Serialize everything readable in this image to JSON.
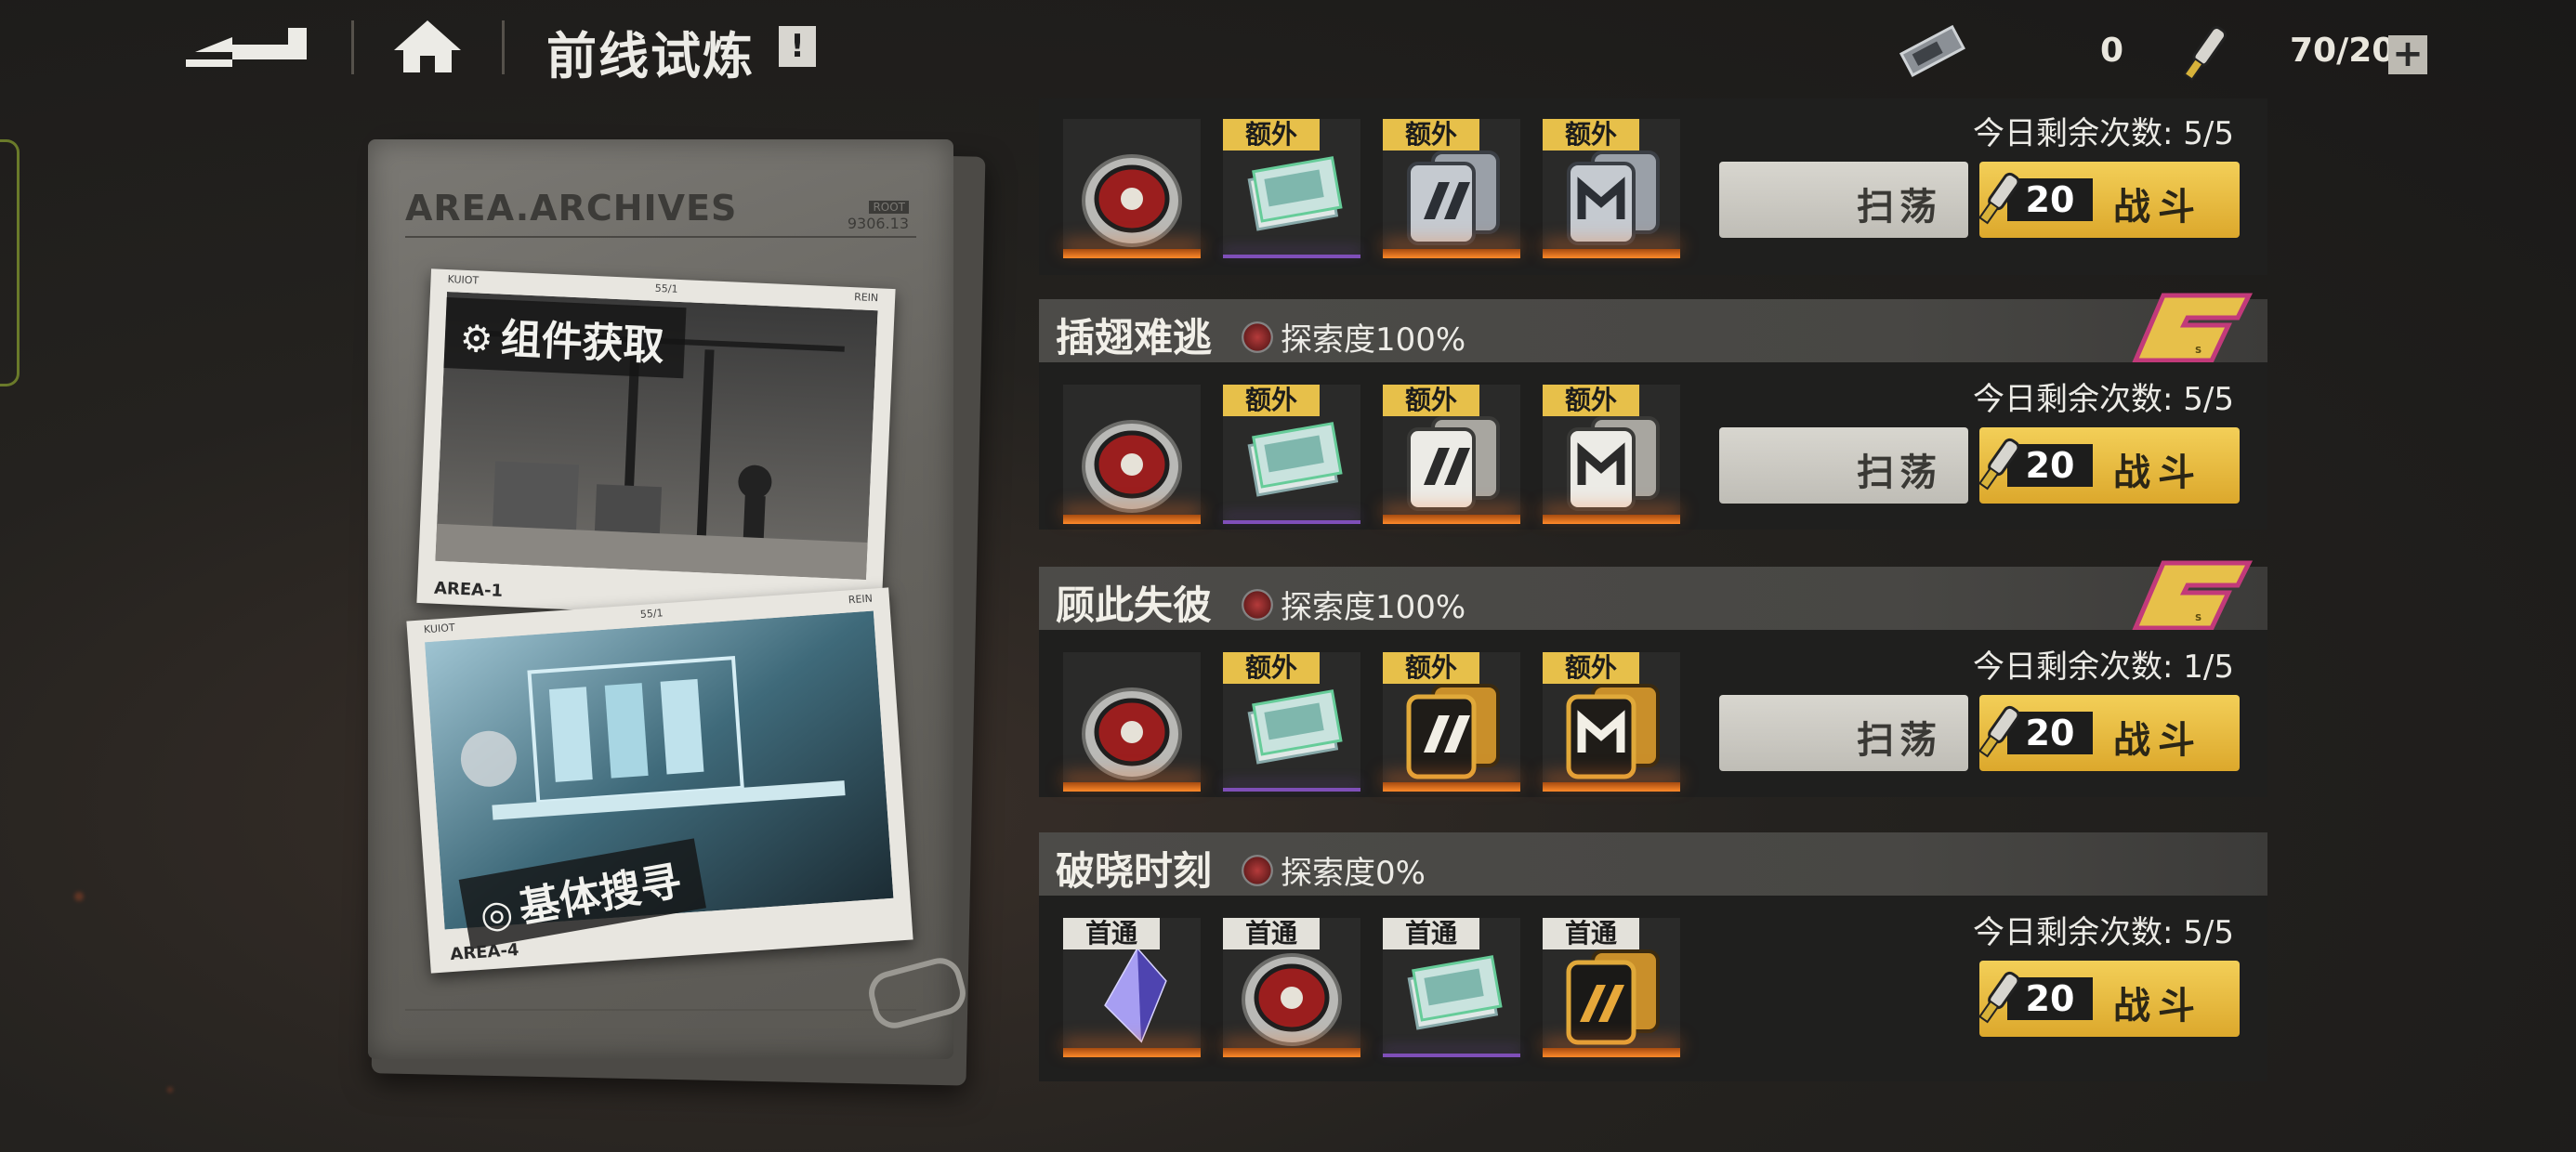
{
  "topbar": {
    "title": "前线试炼",
    "info_mark": "!",
    "resource_1_value": "0",
    "resource_2_value": "70/200",
    "plus_label": "+"
  },
  "folder": {
    "archive_title": "AREA.ARCHIVES",
    "archive_code_tag": "ROOT",
    "archive_code": "9306.13",
    "photos": [
      {
        "label": "组件获取",
        "area": "AREA-1",
        "top_left": "KUIOT",
        "top_mid": "55/1",
        "top_right": "REIN"
      },
      {
        "label": "基体搜寻",
        "area": "AREA-4",
        "top_left": "KUIOT",
        "top_mid": "55/1",
        "top_right": "REIN"
      }
    ]
  },
  "stages": [
    {
      "name": "",
      "explore": "",
      "daily": "今日剩余次数: 5/5",
      "sweep_label": "扫荡",
      "fight_label": "战斗",
      "cost": "20",
      "rank": "",
      "items": [
        {
          "tag": "",
          "art": "coin"
        },
        {
          "tag": "额外",
          "art": "cards"
        },
        {
          "tag": "额外",
          "art": "chip-silver-1"
        },
        {
          "tag": "额外",
          "art": "chip-silver-2"
        }
      ]
    },
    {
      "name": "插翅难逃",
      "explore": "探索度100%",
      "daily": "今日剩余次数: 5/5",
      "sweep_label": "扫荡",
      "fight_label": "战斗",
      "cost": "20",
      "rank": "S",
      "items": [
        {
          "tag": "",
          "art": "coin"
        },
        {
          "tag": "额外",
          "art": "cards"
        },
        {
          "tag": "额外",
          "art": "chip-white-1"
        },
        {
          "tag": "额外",
          "art": "chip-white-2"
        }
      ]
    },
    {
      "name": "顾此失彼",
      "explore": "探索度100%",
      "daily": "今日剩余次数: 1/5",
      "sweep_label": "扫荡",
      "fight_label": "战斗",
      "cost": "20",
      "rank": "S",
      "items": [
        {
          "tag": "",
          "art": "coin"
        },
        {
          "tag": "额外",
          "art": "cards"
        },
        {
          "tag": "额外",
          "art": "chip-gold-1"
        },
        {
          "tag": "额外",
          "art": "chip-gold-2"
        }
      ]
    },
    {
      "name": "破晓时刻",
      "explore": "探索度0%",
      "daily": "今日剩余次数: 5/5",
      "sweep_label": "",
      "fight_label": "战斗",
      "cost": "20",
      "rank": "",
      "items": [
        {
          "tag": "首通",
          "art": "crystal"
        },
        {
          "tag": "首通",
          "art": "coin"
        },
        {
          "tag": "首通",
          "art": "cards"
        },
        {
          "tag": "首通",
          "art": "chip-black"
        }
      ]
    }
  ],
  "colors": {
    "accent_gold": "#e7c04a",
    "panel_dark": "#1f1f1e",
    "rarity_orange": "#ff8a2a",
    "rarity_purple": "#7f4fb8"
  }
}
